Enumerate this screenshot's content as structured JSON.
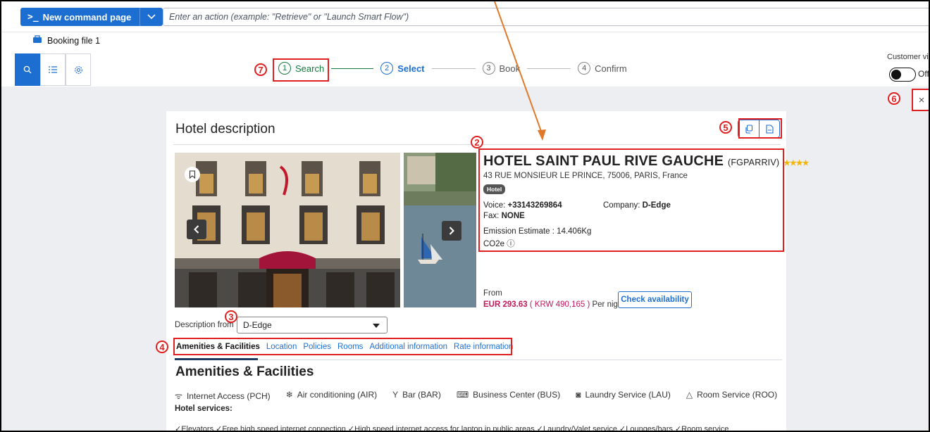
{
  "topbar": {
    "new_command_label": "New command page",
    "command_placeholder": "Enter an action (example: \"Retrieve\" or \"Launch Smart Flow\")"
  },
  "booking_file": "Booking file 1",
  "stepper": {
    "steps": [
      {
        "num": "1",
        "label": "Search"
      },
      {
        "num": "2",
        "label": "Select"
      },
      {
        "num": "3",
        "label": "Book"
      },
      {
        "num": "4",
        "label": "Confirm"
      }
    ]
  },
  "customer_view": {
    "label": "Customer vi",
    "toggle_label": "Off"
  },
  "annotations": {
    "n1": "2",
    "n2": "3",
    "n3": "4",
    "n4": "5",
    "n5": "6",
    "n6": "7"
  },
  "close_label": "×",
  "card": {
    "title": "Hotel description",
    "hotel_name": "HOTEL SAINT PAUL RIVE GAUCHE",
    "hotel_code": "(FGPARRIV)",
    "stars": "★★★★",
    "address": "43 RUE MONSIEUR LE PRINCE, 75006, PARIS, France",
    "badge": "Hotel",
    "voice_label": "Voice: ",
    "voice_value": "+33143269864",
    "company_label": "Company: ",
    "company_value": "D-Edge",
    "fax_label": "Fax: ",
    "fax_value": "NONE",
    "emission": "Emission Estimate : 14.406Kg",
    "co2": "CO2e ⓘ",
    "from_label": "From",
    "price_eur": "EUR 293.63",
    "price_krw": " ( KRW 490,165 )",
    "per_night": " Per night",
    "check_button": "Check availability",
    "description_from_label": "Description from",
    "description_source": "D-Edge",
    "tabs": [
      "Amenities & Facilities",
      "Location",
      "Policies",
      "Rooms",
      "Additional information",
      "Rate information"
    ],
    "section_title": "Amenities & Facilities",
    "amenities": [
      {
        "icon": "wifi-icon",
        "glyph": "ᯤ",
        "text": "Internet Access (PCH)"
      },
      {
        "icon": "snowflake-icon",
        "glyph": "❄",
        "text": "Air conditioning (AIR)"
      },
      {
        "icon": "cocktail-icon",
        "glyph": "Y",
        "text": "Bar (BAR)"
      },
      {
        "icon": "business-center-icon",
        "glyph": "⌨",
        "text": "Business Center (BUS)"
      },
      {
        "icon": "laundry-icon",
        "glyph": "◙",
        "text": "Laundry Service (LAU)"
      },
      {
        "icon": "room-service-icon",
        "glyph": "△",
        "text": "Room Service (ROO)"
      }
    ],
    "hotel_services_label": "Hotel services:",
    "services_line": "✓Elevators ✓Free high speed internet connection ✓High speed internet access for laptop in public areas ✓Laundry/Valet service ✓Lounges/bars ✓Room service"
  },
  "colors": {
    "accent": "#1c6fd1",
    "success": "#147a3d",
    "annotation": "#e02020",
    "price": "#c2185b",
    "arrow": "#e07a2a"
  }
}
